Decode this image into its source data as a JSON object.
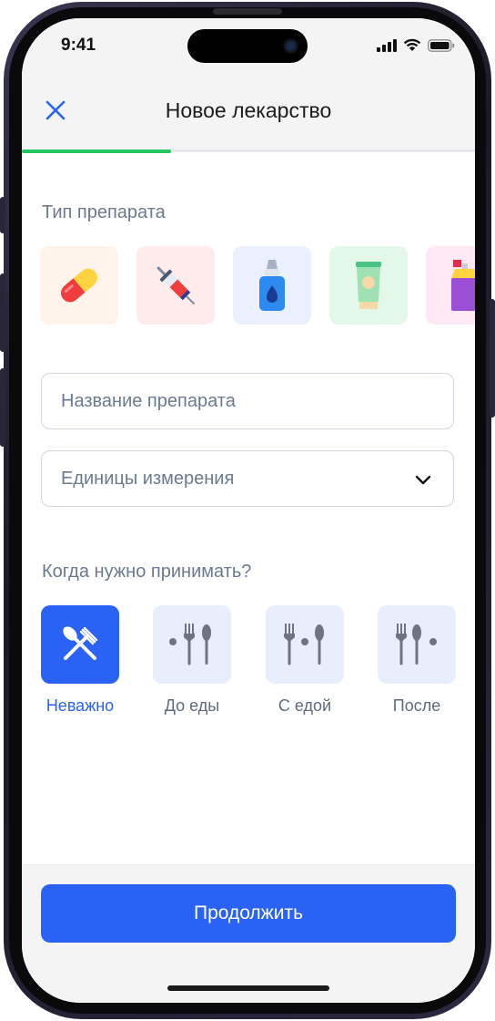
{
  "status_bar": {
    "time": "9:41"
  },
  "header": {
    "title": "Новое лекарство",
    "progress": 0.33
  },
  "drug_type": {
    "label": "Тип препарата",
    "options": [
      {
        "icon": "pill-icon",
        "bg": "#fff3ec"
      },
      {
        "icon": "syringe-icon",
        "bg": "#fdeceb"
      },
      {
        "icon": "dropper-bottle-icon",
        "bg": "#eaf0fd"
      },
      {
        "icon": "cream-tube-icon",
        "bg": "#e3f8e8"
      },
      {
        "icon": "spray-bottle-icon",
        "bg": "#fde8f3"
      }
    ]
  },
  "form": {
    "name_placeholder": "Название препарата",
    "units_placeholder": "Единицы измерения"
  },
  "when": {
    "label": "Когда нужно принимать?",
    "options": [
      {
        "label": "Неважно",
        "icon": "fork-knife-cross-icon",
        "selected": true
      },
      {
        "label": "До еды",
        "icon": "before-meal-icon",
        "selected": false
      },
      {
        "label": "С едой",
        "icon": "with-meal-icon",
        "selected": false
      },
      {
        "label": "После",
        "icon": "after-meal-icon",
        "selected": false
      }
    ]
  },
  "footer": {
    "continue_label": "Продолжить"
  },
  "colors": {
    "accent": "#2a62f5",
    "progress": "#22c55e",
    "muted_text": "#6b7a90",
    "tile_inactive": "#e8eefb"
  }
}
